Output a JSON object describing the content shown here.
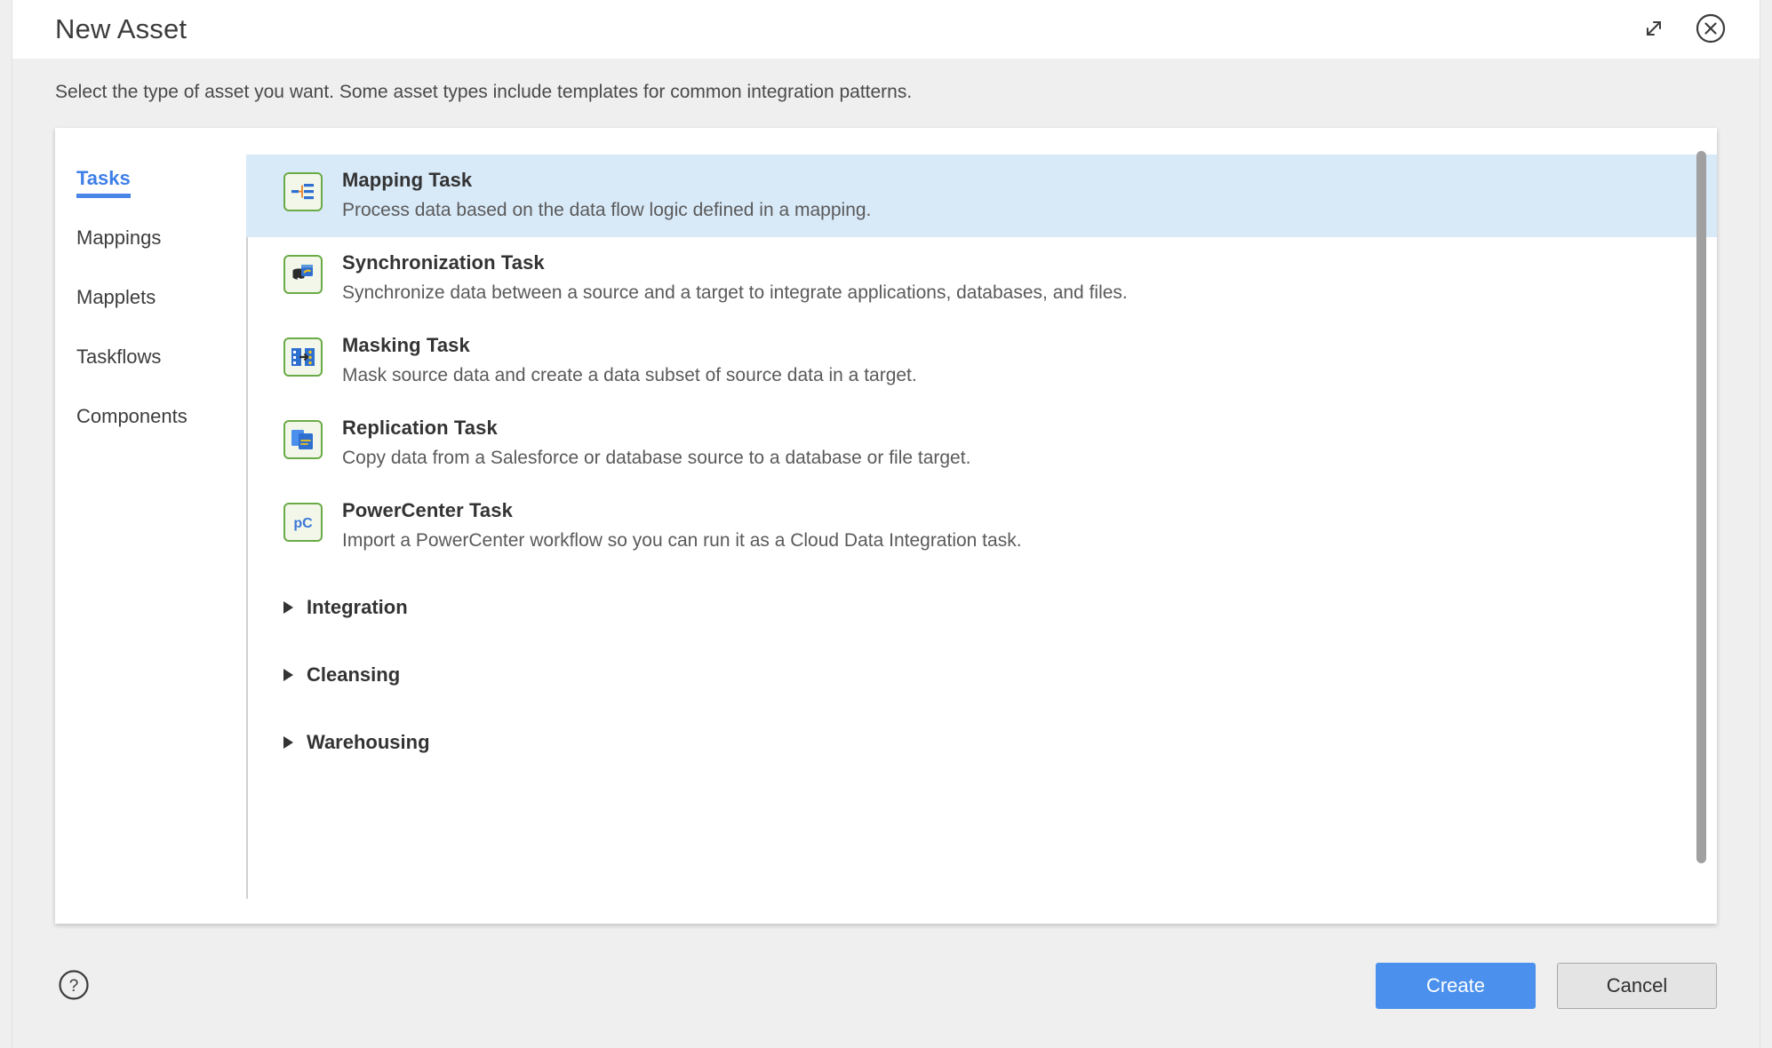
{
  "dialog": {
    "title": "New Asset",
    "subtitle": "Select the type of asset you want. Some asset types include templates for common integration patterns.",
    "expand_icon": "expand-icon",
    "close_icon": "close-circle-icon"
  },
  "sidebar": {
    "items": [
      {
        "label": "Tasks",
        "active": true
      },
      {
        "label": "Mappings",
        "active": false
      },
      {
        "label": "Mapplets",
        "active": false
      },
      {
        "label": "Taskflows",
        "active": false
      },
      {
        "label": "Components",
        "active": false
      }
    ]
  },
  "assets": [
    {
      "title": "Mapping Task",
      "description": "Process data based on the data flow logic defined in a mapping.",
      "icon": "mapping-task-icon",
      "selected": true
    },
    {
      "title": "Synchronization Task",
      "description": "Synchronize data between a source and a target to integrate applications, databases, and files.",
      "icon": "synchronization-task-icon",
      "selected": false
    },
    {
      "title": "Masking Task",
      "description": "Mask source data and create a data subset of source data in a target.",
      "icon": "masking-task-icon",
      "selected": false
    },
    {
      "title": "Replication Task",
      "description": "Copy data from a Salesforce or database source to a database or file target.",
      "icon": "replication-task-icon",
      "selected": false
    },
    {
      "title": "PowerCenter Task",
      "description": "Import a PowerCenter workflow so you can run it as a Cloud Data Integration task.",
      "icon": "powercenter-task-icon",
      "selected": false
    }
  ],
  "groups": [
    {
      "label": "Integration",
      "expanded": false
    },
    {
      "label": "Cleansing",
      "expanded": false
    },
    {
      "label": "Warehousing",
      "expanded": false
    }
  ],
  "footer": {
    "help_icon": "help-circle-icon",
    "create_label": "Create",
    "cancel_label": "Cancel"
  },
  "colors": {
    "accent": "#4a90ec",
    "selected_row": "#d8e9f8",
    "icon_border": "#6aab46",
    "sidebar_active": "#3f7fe8",
    "panel_bg": "#efefef"
  }
}
